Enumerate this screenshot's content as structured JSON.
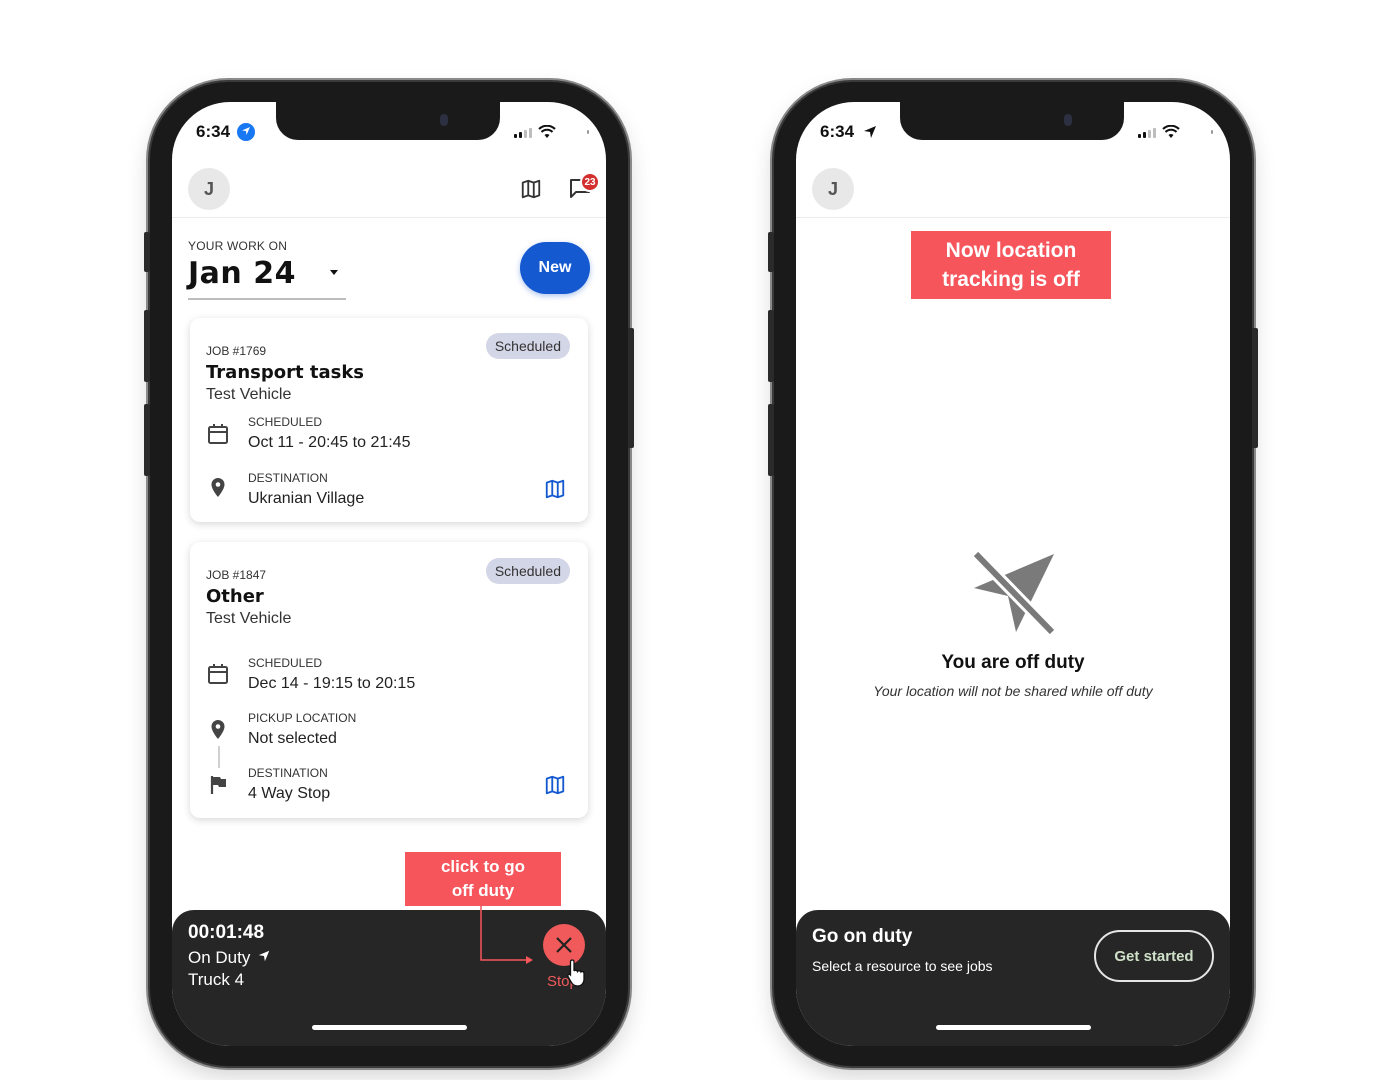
{
  "left_phone": {
    "status_time": "6:34",
    "avatar_initial": "J",
    "chat_badge": "23",
    "work_on_label": "YOUR WORK ON",
    "date": "Jan 24",
    "new_label": "New",
    "jobs": [
      {
        "job_number": "JOB #1769",
        "status": "Scheduled",
        "title": "Transport tasks",
        "vehicle": "Test Vehicle",
        "scheduled_label": "SCHEDULED",
        "scheduled_value": "Oct 11 - 20:45 to 21:45",
        "destination_label": "DESTINATION",
        "destination_value": "Ukranian Village"
      },
      {
        "job_number": "JOB #1847",
        "status": "Scheduled",
        "title": "Other",
        "vehicle": "Test Vehicle",
        "scheduled_label": "SCHEDULED",
        "scheduled_value": "Dec 14 - 19:15 to 20:15",
        "pickup_label": "PICKUP LOCATION",
        "pickup_value": "Not selected",
        "destination_label": "DESTINATION",
        "destination_value": "4 Way Stop"
      }
    ],
    "annotation": "click to go off duty",
    "bottom_bar": {
      "timer": "00:01:48",
      "duty_status": "On Duty",
      "truck": "Truck 4",
      "stop_label": "Stop"
    }
  },
  "right_phone": {
    "status_time": "6:34",
    "avatar_initial": "J",
    "annotation": "Now location tracking is off",
    "off_duty_title": "You are off duty",
    "off_duty_message": "Your location will not be shared while off duty",
    "bottom_bar": {
      "title": "Go on duty",
      "subtitle": "Select a resource to see jobs",
      "button_label": "Get started"
    }
  },
  "colors": {
    "primary_blue": "#1459d0",
    "annotation_red": "#f5555b",
    "stop_red": "#f05a5a",
    "chip_bg": "#d3d6e6",
    "bottom_bar_bg": "#262626"
  }
}
